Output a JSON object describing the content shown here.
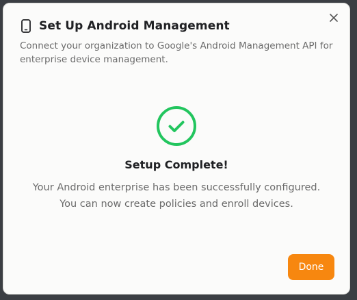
{
  "dialog": {
    "title": "Set Up Android Management",
    "description": "Connect your organization to Google's Android Management API for enterprise device management.",
    "close_icon": "close-icon",
    "header_icon": "phone-icon"
  },
  "status": {
    "icon": "check-circle-icon",
    "title": "Setup Complete!",
    "message_line1": "Your Android enterprise has been successfully configured.",
    "message_line2": "You can now create policies and enroll devices."
  },
  "actions": {
    "done_label": "Done"
  },
  "colors": {
    "accent": "#f7870f",
    "success": "#22c55e"
  }
}
